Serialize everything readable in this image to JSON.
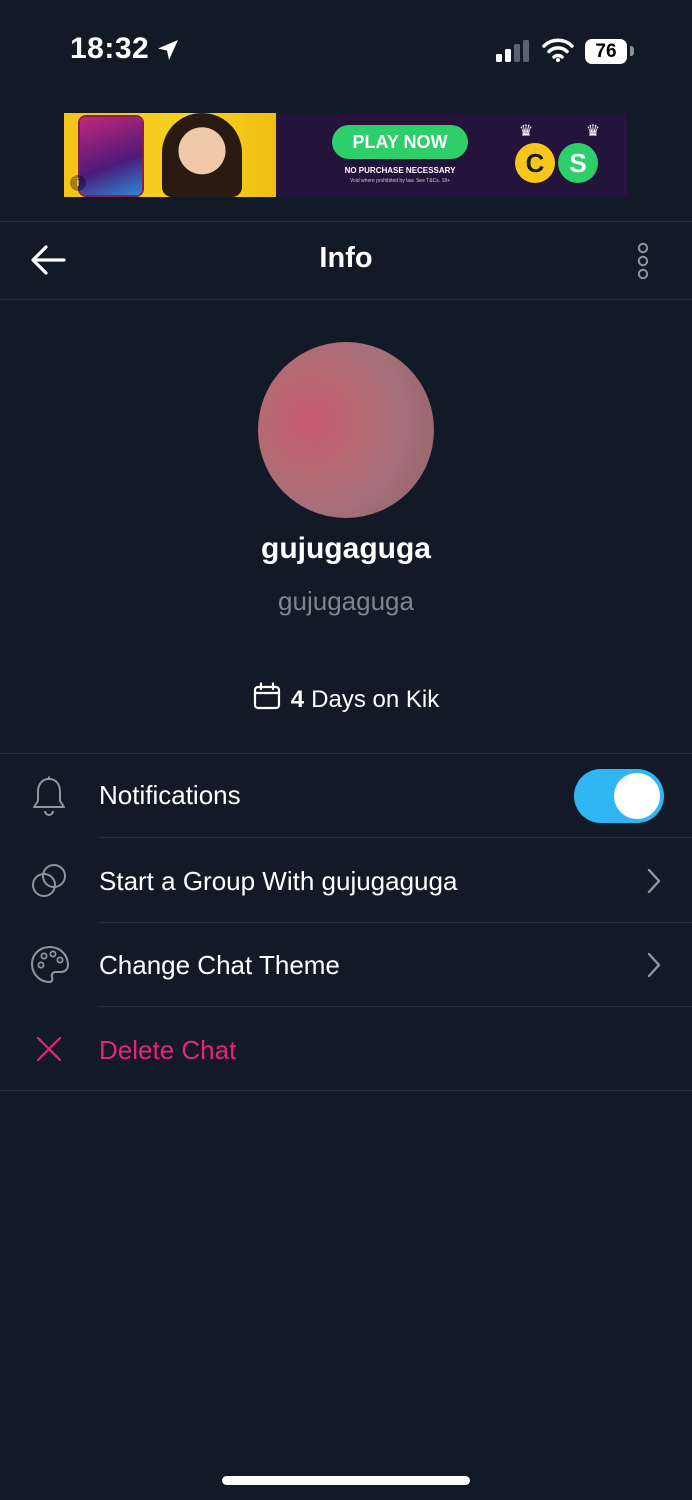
{
  "status_bar": {
    "time": "18:32",
    "battery": "76"
  },
  "ad": {
    "cta": "PLAY NOW",
    "disclaimer": "NO PURCHASE NECESSARY",
    "fine_print": "Void where prohibited by law. See T&Cs. 18+",
    "logo_letters": [
      "C",
      "S"
    ],
    "info": "i"
  },
  "header": {
    "title": "Info"
  },
  "profile": {
    "display_name": "gujugaguga",
    "username": "gujugaguga",
    "days_count": "4",
    "days_label": "Days on Kik"
  },
  "menu": {
    "notifications": {
      "label": "Notifications",
      "enabled": true
    },
    "start_group": {
      "label": "Start a Group With gujugaguga"
    },
    "chat_theme": {
      "label": "Change Chat Theme"
    },
    "delete_chat": {
      "label": "Delete Chat"
    }
  },
  "colors": {
    "background": "#121a27",
    "toggle_on": "#2fb6f3",
    "danger": "#e8237a",
    "muted_text": "#7e8591"
  },
  "icons": [
    "location-arrow-icon",
    "cellular-signal-icon",
    "wifi-icon",
    "battery-icon",
    "back-arrow-icon",
    "more-vertical-icon",
    "calendar-icon",
    "bell-icon",
    "group-circles-icon",
    "palette-icon",
    "close-x-icon",
    "chevron-right-icon"
  ]
}
